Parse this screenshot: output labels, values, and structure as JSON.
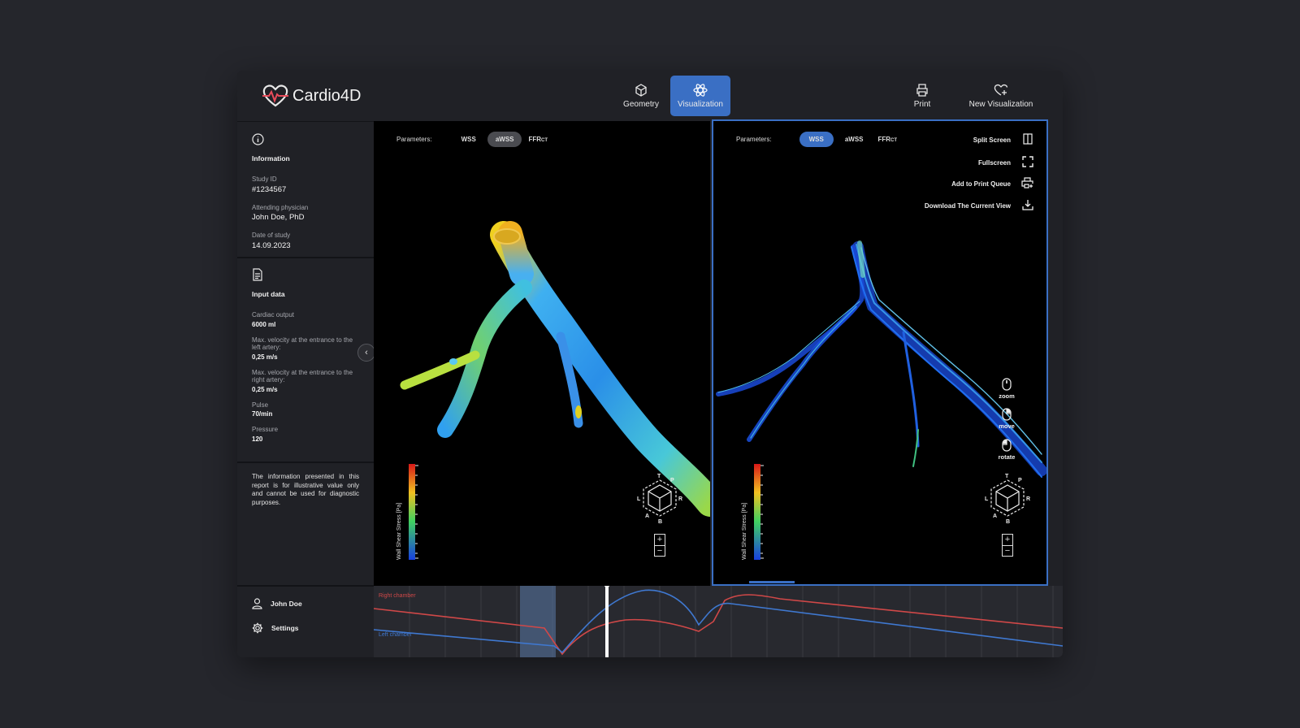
{
  "app": {
    "name": "Cardio4D"
  },
  "nav": [
    {
      "label": "Geometry",
      "icon": "cube-icon"
    },
    {
      "label": "Visualization",
      "icon": "atom-icon",
      "active": true
    }
  ],
  "actions": [
    {
      "label": "Print",
      "icon": "printer-icon"
    },
    {
      "label": "New Visualization",
      "icon": "heart-plus-icon"
    }
  ],
  "information": {
    "title": "Information",
    "fields": [
      {
        "label": "Study ID",
        "value": "#1234567"
      },
      {
        "label": "Attending physician",
        "value": "John Doe, PhD"
      },
      {
        "label": "Date of study",
        "value": "14.09.2023"
      }
    ]
  },
  "input_data": {
    "title": "Input data",
    "fields": [
      {
        "label": "Cardiac output",
        "value": "6000 ml"
      },
      {
        "label": "Max. velocity at the entrance to the left artery:",
        "value": "0,25 m/s"
      },
      {
        "label": "Max. velocity at the entrance to the right artery:",
        "value": "0,25 m/s"
      },
      {
        "label": "Pulse",
        "value": "70/min"
      },
      {
        "label": "Pressure",
        "value": "120"
      }
    ]
  },
  "disclaimer": "The information presented in this report is for illustrative value only and cannot be used for diagnostic purposes.",
  "user": {
    "name": "John Doe",
    "settings_label": "Settings"
  },
  "viewports": {
    "params_label": "Parameters:",
    "options": [
      "WSS",
      "aWSS",
      "FFR",
      "CT"
    ],
    "left_selected": "aWSS",
    "right_selected": "WSS",
    "colorbar_label": "Wall Shear Stress [Pa]",
    "tools": [
      "Split Screen",
      "Fullscreen",
      "Add to Print Queue",
      "Download The Current View"
    ],
    "mouse_controls": [
      "zoom",
      "move",
      "rotate"
    ],
    "cube_letters": [
      "T",
      "P",
      "L",
      "R",
      "A",
      "B"
    ],
    "zoom_in": "+",
    "zoom_out": "−"
  },
  "timeline": {
    "series": [
      {
        "name": "Right chamber",
        "color": "#d04848"
      },
      {
        "name": "Left chamber",
        "color": "#3f78d0"
      }
    ]
  },
  "colors": {
    "accent": "#3a6fc4",
    "background": "#25262c",
    "panel": "#202126"
  }
}
